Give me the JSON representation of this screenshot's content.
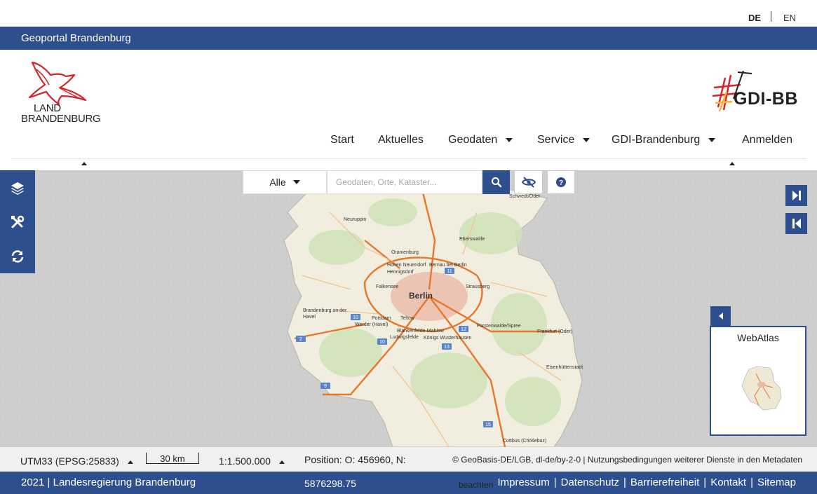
{
  "language": {
    "active": "DE",
    "other": "EN"
  },
  "topbar": {
    "title": "Geoportal Brandenburg"
  },
  "logos": {
    "left_text_line1": "LAND",
    "left_text_line2": "BRANDENBURG",
    "right_text": "GDI-BB"
  },
  "nav": {
    "items": [
      {
        "label": "Start",
        "dropdown": false
      },
      {
        "label": "Aktuelles",
        "dropdown": false
      },
      {
        "label": "Geodaten",
        "dropdown": true
      },
      {
        "label": "Service",
        "dropdown": true
      },
      {
        "label": "GDI-Brandenburg",
        "dropdown": true
      },
      {
        "label": "Anmelden",
        "dropdown": false
      }
    ]
  },
  "sidebar": {
    "icons": [
      "layers-icon",
      "tools-icon",
      "refresh-icon"
    ]
  },
  "search": {
    "category": "Alle",
    "placeholder": "Geodaten, Orte, Kataster...",
    "value": ""
  },
  "map": {
    "labels": [
      "Schwedt/Oder",
      "Neuruppin",
      "Eberswalde",
      "Oranienburg",
      "Hohen Neuendorf",
      "Bernau bei Berlin",
      "Hennigsdorf",
      "Falkensee",
      "Strausberg",
      "Berlin",
      "Brandenburg an der Havel",
      "Potsdam",
      "Teltow",
      "Werder (Havel)",
      "Fürstenwalde/Spree",
      "Frankfurt (Oder)",
      "Blankenfelde-Mahlow",
      "Ludwigsfelde",
      "Königs Wusterhausen",
      "Eisenhüttenstadt",
      "Cottbus (Chóśebuz)"
    ],
    "road_shields": [
      "11",
      "10",
      "10",
      "12",
      "2",
      "10",
      "13",
      "9",
      "15"
    ]
  },
  "overview": {
    "title": "WebAtlas"
  },
  "status": {
    "crs": "UTM33 (EPSG:25833)",
    "scale_label": "30 km",
    "scale": "1:1.500.000",
    "position_line1": "Position: O: 456960, N:",
    "position_line2": "5876298.75",
    "attribution": "© GeoBasis-DE/LGB, dl-de/by-2-0 | Nutzungsbedingungen weiterer Dienste in den Metadaten",
    "attribution_cont": "beachten"
  },
  "footer": {
    "left": "2021 | Landesregierung Brandenburg",
    "links": [
      "Impressum",
      "Datenschutz",
      "Barrierefreiheit",
      "Kontakt",
      "Sitemap"
    ]
  },
  "colors": {
    "primary": "#2d4f8d",
    "map_bg": "#cfcfcf",
    "road": "#e8762b",
    "logo_red": "#d8232a"
  }
}
